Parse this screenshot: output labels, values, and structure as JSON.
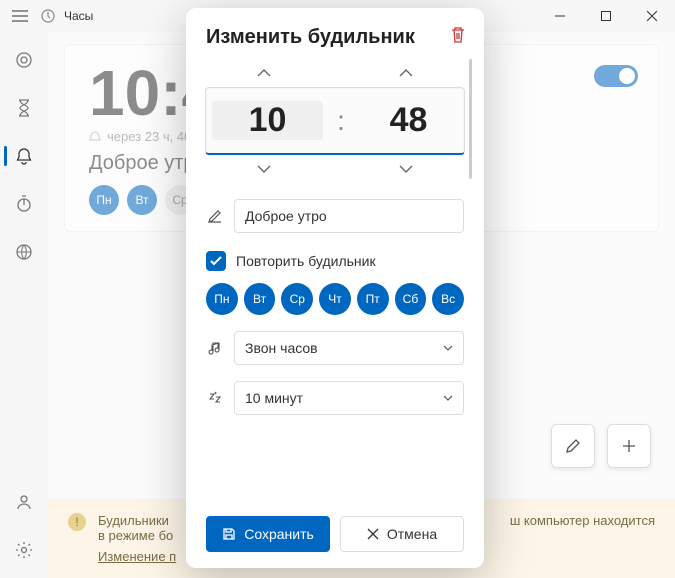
{
  "titlebar": {
    "app_name": "Часы"
  },
  "background_card": {
    "time": "10:4",
    "meta": "через 23 ч, 40",
    "name": "Доброе утр",
    "days": [
      "Пн",
      "Вт",
      "Ср"
    ]
  },
  "banner": {
    "line1": "Будильники",
    "line1_suffix": "ш компьютер находится",
    "line2": "в режиме бо",
    "link": "Изменение п"
  },
  "modal": {
    "title": "Изменить будильник",
    "hour": "10",
    "minute": "48",
    "name_value": "Доброе утро",
    "repeat_label": "Повторить будильник",
    "days": [
      "Пн",
      "Вт",
      "Ср",
      "Чт",
      "Пт",
      "Сб",
      "Вс"
    ],
    "sound_value": "Звон часов",
    "snooze_value": "10 минут",
    "save_label": "Сохранить",
    "cancel_label": "Отмена"
  }
}
